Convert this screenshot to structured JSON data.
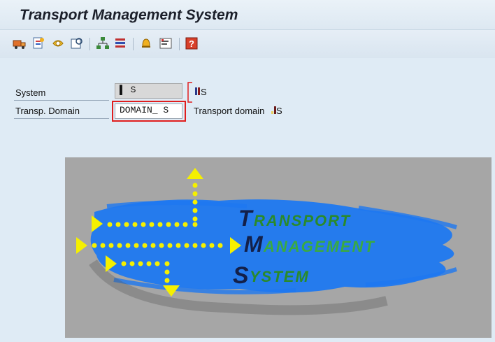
{
  "window": {
    "title": "Transport Management System"
  },
  "toolbar": {
    "buttons": [
      {
        "icon": "truck-import-icon"
      },
      {
        "icon": "transport-routes-icon"
      },
      {
        "icon": "configuration-icon"
      },
      {
        "icon": "display-overview-icon"
      },
      {
        "icon": "system-hierarchy-icon"
      },
      {
        "icon": "import-queue-icon"
      },
      {
        "icon": "alert-bell-icon"
      },
      {
        "icon": "settings-list-icon"
      },
      {
        "icon": "help-icon"
      }
    ]
  },
  "form": {
    "system_label": "System",
    "system_value": "▌ S",
    "system_desc": "S",
    "domain_label": "Transp. Domain",
    "domain_value": "DOMAIN_   S",
    "domain_desc_text": "Transport domain",
    "domain_desc_code": "S"
  },
  "logo": {
    "line1_initial": "T",
    "line1_rest": "RANSPORT",
    "line2_initial": "M",
    "line2_rest": "ANAGEMENT",
    "line3_initial": "S",
    "line3_rest": "YSTEM"
  },
  "colors": {
    "background": "#dfebf5",
    "brush_blue": "#1e78f0",
    "arrow_yellow": "#f5f000",
    "highlight_red": "#e01e1e"
  }
}
